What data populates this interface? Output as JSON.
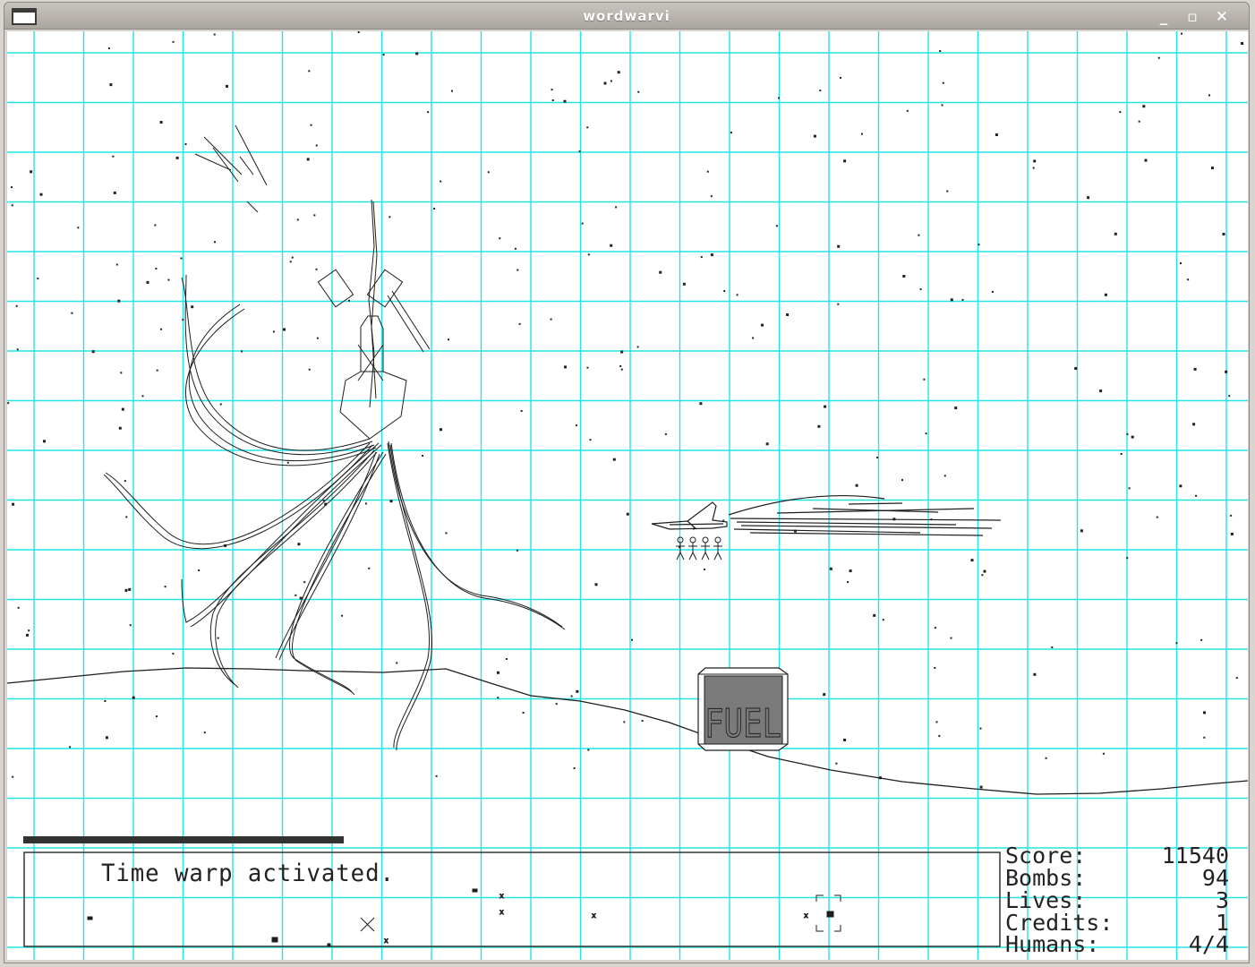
{
  "window": {
    "title": "wordwarvi",
    "min_glyph": "_",
    "max_glyph": "▫",
    "close_glyph": "✕"
  },
  "colors": {
    "grid": "#22e3e6",
    "ink": "#1e1e1e",
    "fuel_fill": "#7a7a7a",
    "background": "#ffffff"
  },
  "message": "Time warp activated.",
  "fuel_label": "FUEL",
  "stats": {
    "score_label": "Score:",
    "score": "11540",
    "bombs_label": "Bombs:",
    "bombs": "94",
    "lives_label": "Lives:",
    "lives": "3",
    "credits_label": "Credits:",
    "credits": "1",
    "humans_label": "Humans:",
    "humans": "4/4"
  }
}
